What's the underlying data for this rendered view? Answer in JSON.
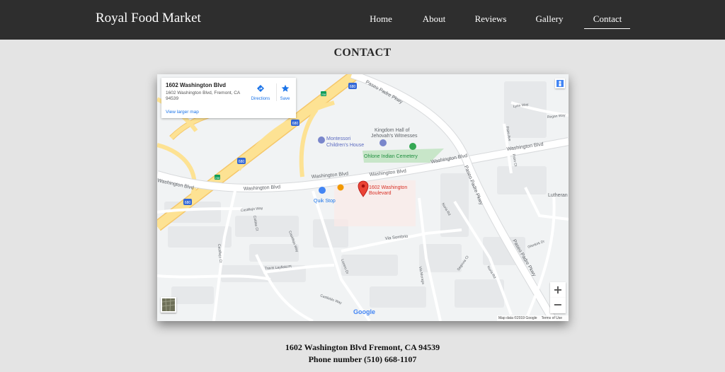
{
  "brand": "Royal Food Market",
  "nav": {
    "items": [
      {
        "label": "Home"
      },
      {
        "label": "About"
      },
      {
        "label": "Reviews"
      },
      {
        "label": "Gallery"
      },
      {
        "label": "Contact"
      }
    ],
    "active": "Contact"
  },
  "section_title": "CONTACT",
  "map": {
    "info_card": {
      "title": "1602 Washington Blvd",
      "address": "1602 Washington Blvd, Fremont, CA 94539",
      "directions_label": "Directions",
      "save_label": "Save",
      "view_larger_label": "View larger map"
    },
    "labels": {
      "pin": "1602 Washington Boulevard",
      "pin_line1": "1602 Washington",
      "pin_line2": "Boulevard",
      "montessori_1": "Montessori",
      "montessori_2": "Children's House",
      "kingdom_1": "Kingdom Hall of",
      "kingdom_2": "Jehovah's Witnesses",
      "cemetery": "Ohlone Indian Cemetery",
      "quik_stop": "Quik Stop",
      "washington_1": "Washington Blvd",
      "washington_2": "Washington Blvd",
      "washington_3": "Washington Blvd",
      "washington_4": "Washington Blvd",
      "washington_5": "Washington Blvd",
      "washington_6": "Washington Blvd",
      "paseo_1": "Paseo Padre Pkwy",
      "paseo_2": "Paseo Padre Pkwy",
      "paseo_3": "Paseo Padre Pkwy",
      "lynn_way": "Lynn Way",
      "regan_way": "Regan Way",
      "palm_ave": "Palm Ave",
      "palm_ct": "Palm Ct",
      "lutheran": "Lutheran",
      "castillejo_way": "Castillejo Way",
      "caldas_ct": "Caldas Ct",
      "castilleja_way": "Castilleja Way",
      "castillejo_ct": "Castillejo Ct",
      "travis_layfield_pl": "Travis Layfield Pl",
      "lucero_dr": "Lucero Dr",
      "via_sombrio": "Via Sombrio",
      "via_moraga": "Via Moraga",
      "segovia_ct": "Segovia Ct",
      "nuria_rd": "Nuria Rd",
      "nuria_rd_2": "Nuria Rd",
      "glenkirk_dr": "Glenkirk Dr",
      "castleblo_way": "Castleblo Way",
      "hwy_680_1": "680",
      "hwy_680_2": "680",
      "hwy_680_3": "680",
      "hwy_680_4": "680",
      "hwy_680_5": "680",
      "route_238_1": "238",
      "route_238_2": "238"
    },
    "google_logo": "Google",
    "attribution": "Map data ©2019 Google",
    "terms": "Terms of Use",
    "zoom_in": "+",
    "zoom_out": "−",
    "colors": {
      "land": "#f1f3f4",
      "highway": "#fde293",
      "highway_edge": "#f5c76a",
      "road": "#ffffff",
      "park": "#c8e6c9",
      "pin": "#ea4335",
      "label_blue": "#1a73e8",
      "label_green": "#1e8e3e"
    }
  },
  "address": "1602 Washington Blvd Fremont, CA 94539",
  "phone": "Phone number (510) 668-1107"
}
